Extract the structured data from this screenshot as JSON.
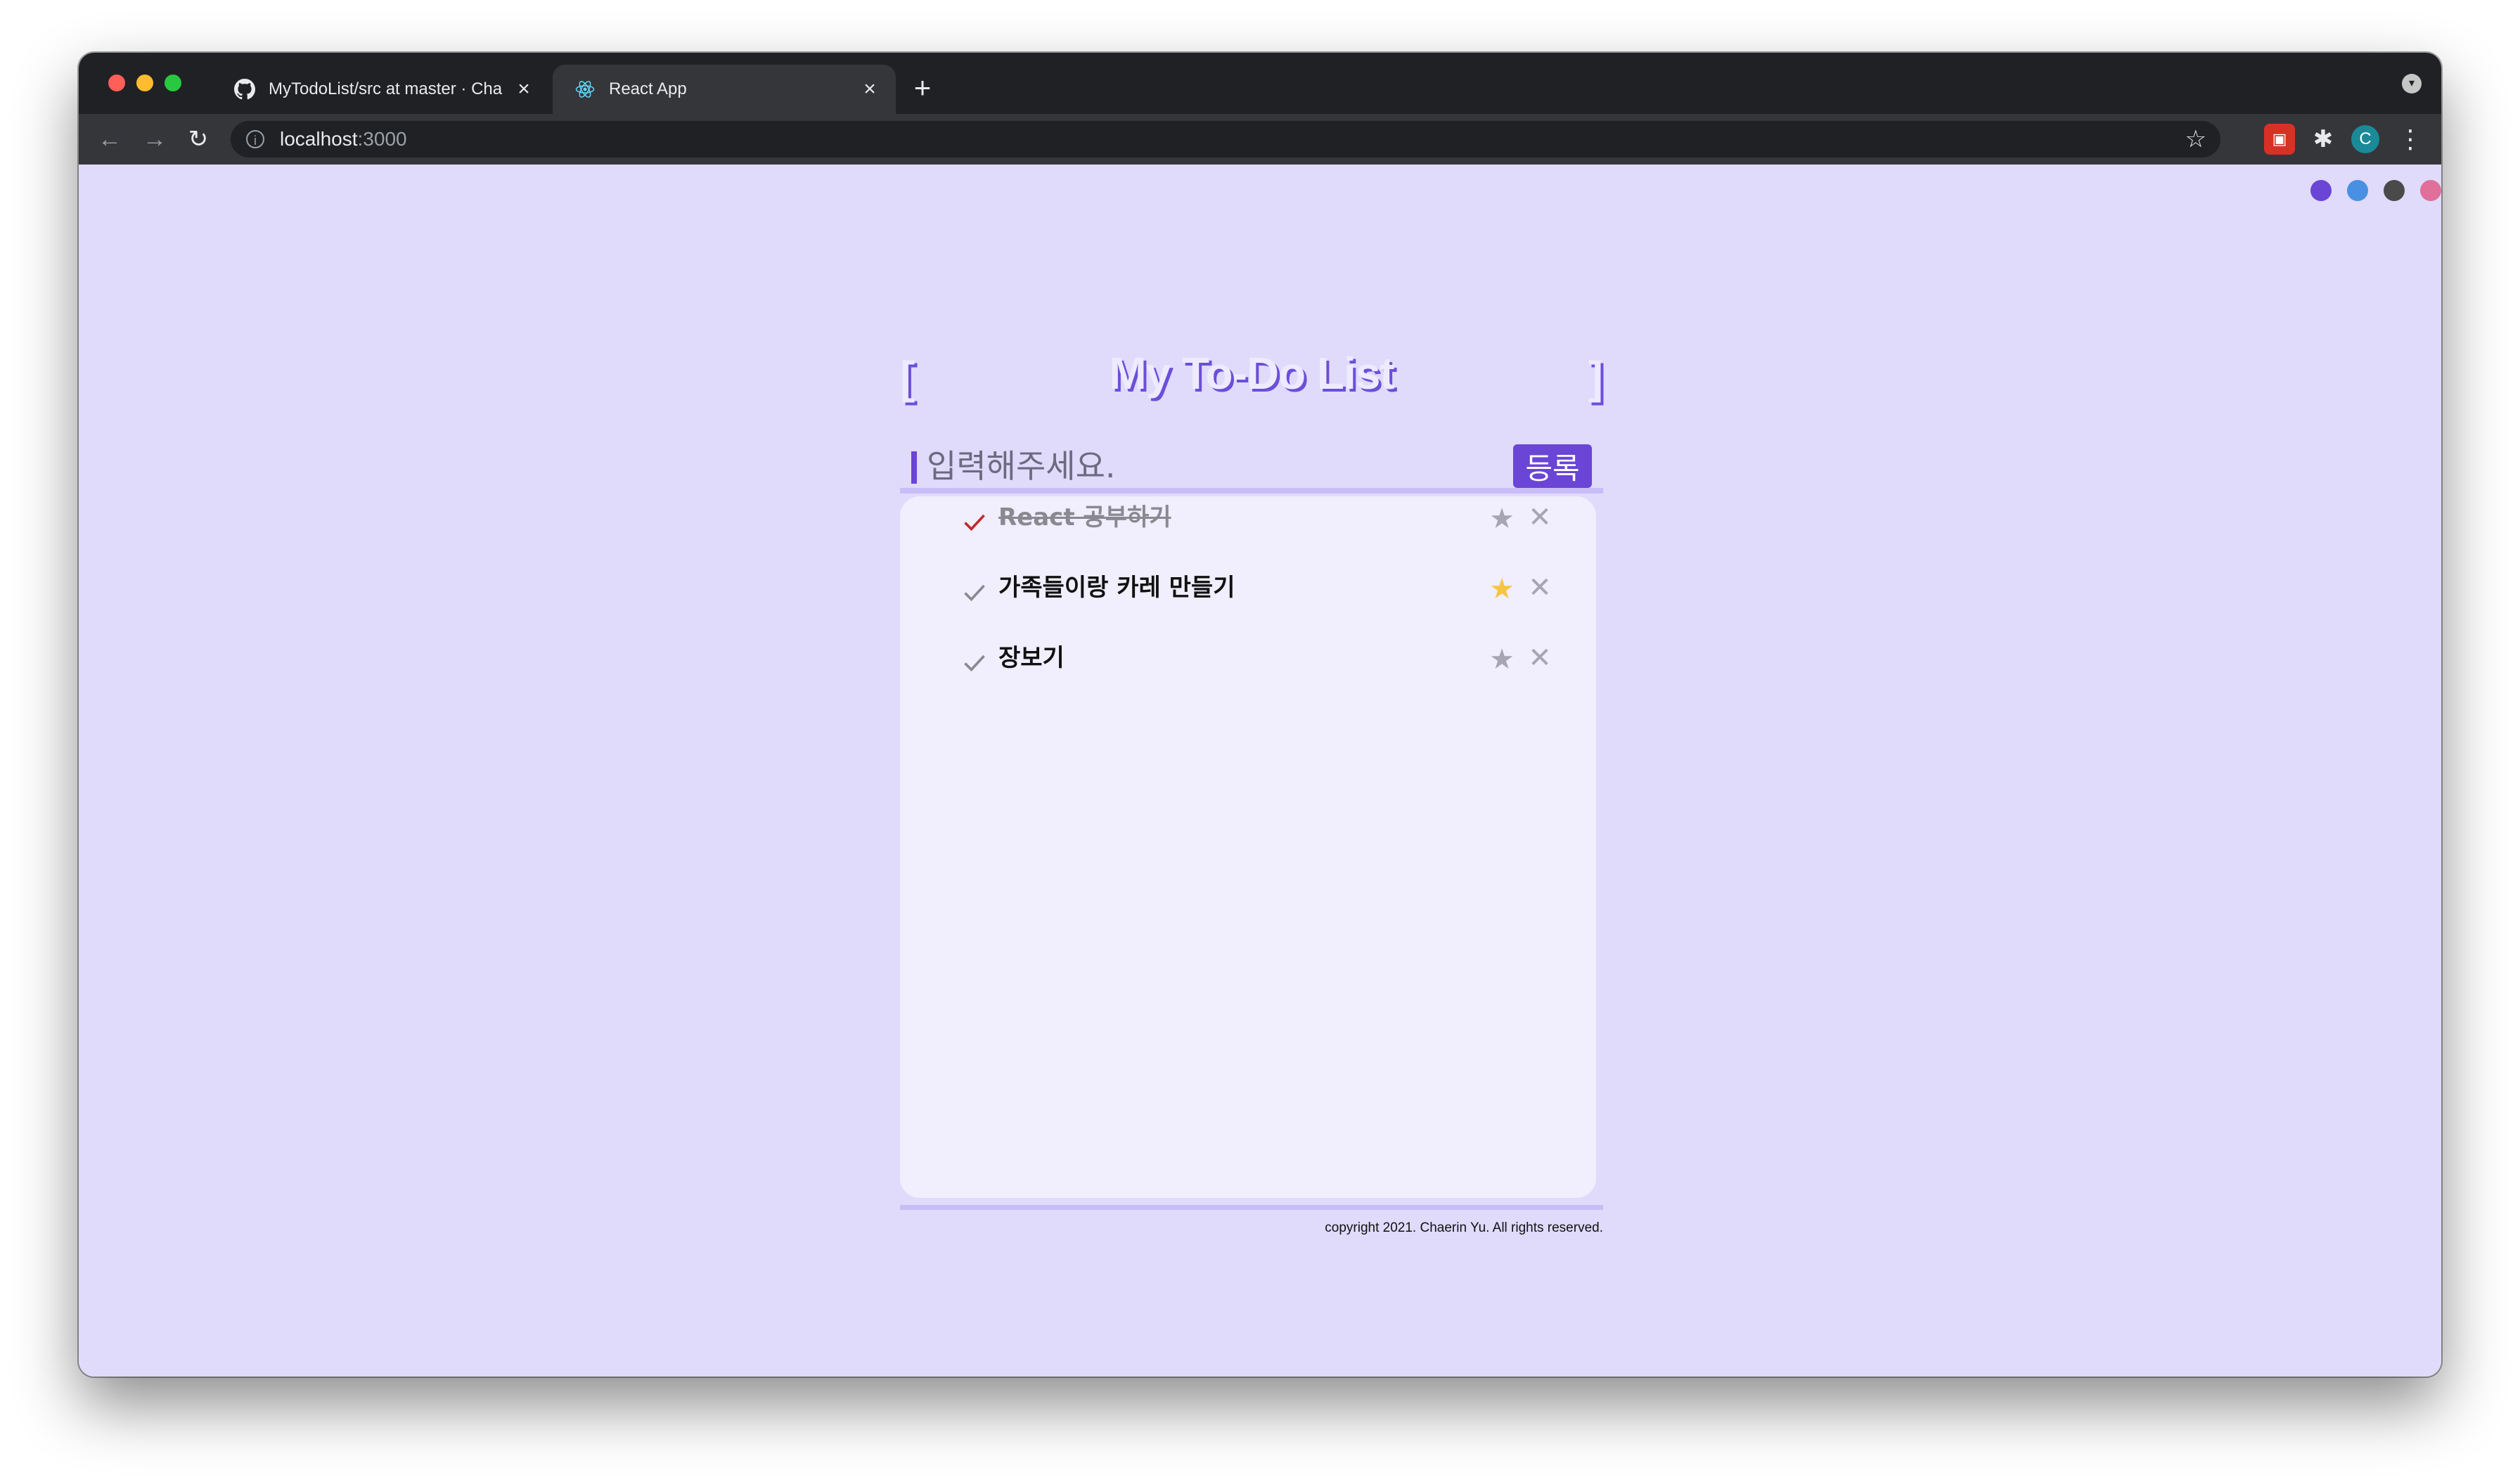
{
  "browser": {
    "tabs": [
      {
        "title": "MyTodoList/src at master · Cha",
        "favicon": "github-icon",
        "active": false
      },
      {
        "title": "React App",
        "favicon": "react-icon",
        "active": true
      }
    ],
    "new_tab_label": "+",
    "url_host": "localhost",
    "url_port": ":3000",
    "avatar_letter": "C"
  },
  "theme_colors": [
    "#6a45d6",
    "#4a90e2",
    "#4a4a4a",
    "#e0709a"
  ],
  "app": {
    "bracket_left": "[",
    "bracket_right": "]",
    "title": "My To-Do List",
    "input_placeholder": "입력해주세요.",
    "submit_label": "등록",
    "todos": [
      {
        "text": "React 공부하기",
        "done": true,
        "starred": false
      },
      {
        "text": "가족들이랑 카레 만들기",
        "done": false,
        "starred": true
      },
      {
        "text": "장보기",
        "done": false,
        "starred": false
      }
    ],
    "copyright": "copyright 2021. Chaerin Yu. All rights reserved."
  },
  "colors": {
    "accent": "#6a45d6",
    "check_done": "#c0282d",
    "check_pending": "#8a8890",
    "star_on": "#f5c542",
    "star_off": "#a7a4b4"
  }
}
